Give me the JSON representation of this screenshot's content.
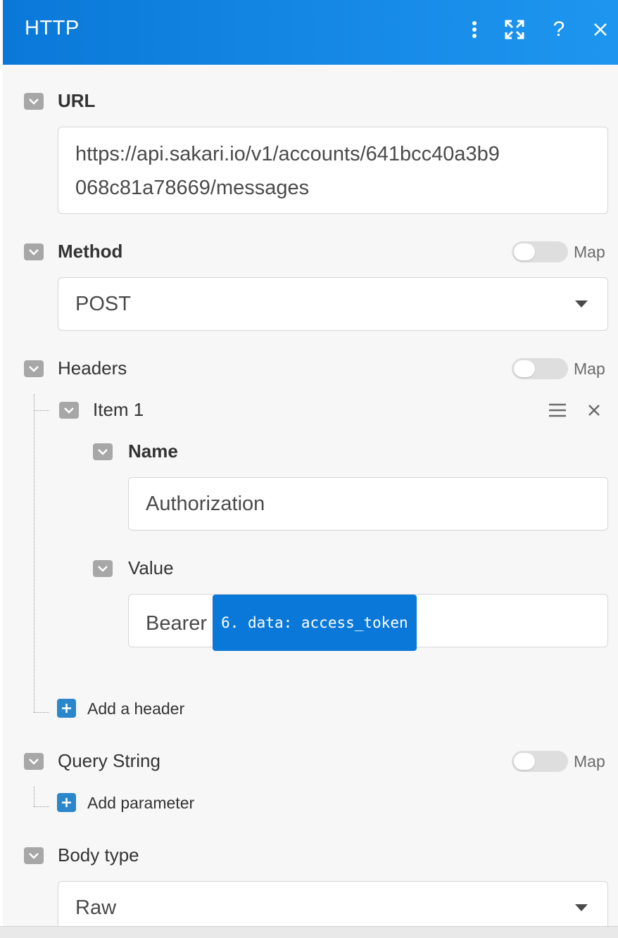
{
  "header": {
    "title": "HTTP",
    "icons": [
      "more-vertical-icon",
      "expand-icon",
      "help-icon",
      "close-icon"
    ]
  },
  "url": {
    "label": "URL",
    "value_line1": "https://api.sakari.io/v1/accounts/641bcc40a3b9",
    "value_line2": "068c81a78669/messages"
  },
  "method": {
    "label": "Method",
    "map_label": "Map",
    "value": "POST"
  },
  "headers": {
    "label": "Headers",
    "map_label": "Map",
    "item": {
      "label": "Item 1",
      "name_label": "Name",
      "name_value": "Authorization",
      "value_label": "Value",
      "value_text": "Bearer",
      "value_token": "6. data: access_token"
    },
    "add_label": "Add a header"
  },
  "query_string": {
    "label": "Query String",
    "map_label": "Map",
    "add_label": "Add parameter"
  },
  "body_type": {
    "label": "Body type",
    "value": "Raw"
  },
  "colors": {
    "header_blue": "#0a78d8",
    "token_blue": "#0a78d8",
    "add_button": "#2a87cc",
    "chevron_bg": "#a7a7a7"
  }
}
